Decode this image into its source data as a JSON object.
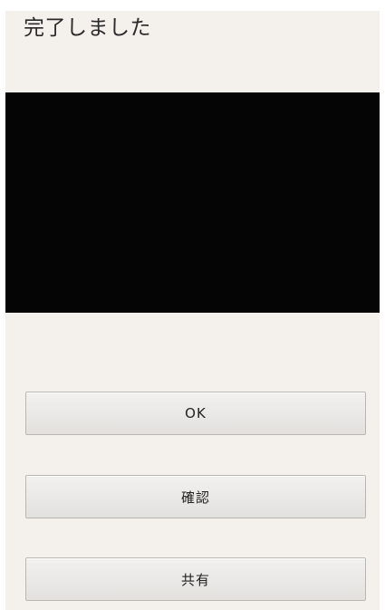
{
  "dialog": {
    "title": "完了しました"
  },
  "buttons": {
    "ok_label": "OK",
    "confirm_label": "確認",
    "share_label": "共有"
  }
}
